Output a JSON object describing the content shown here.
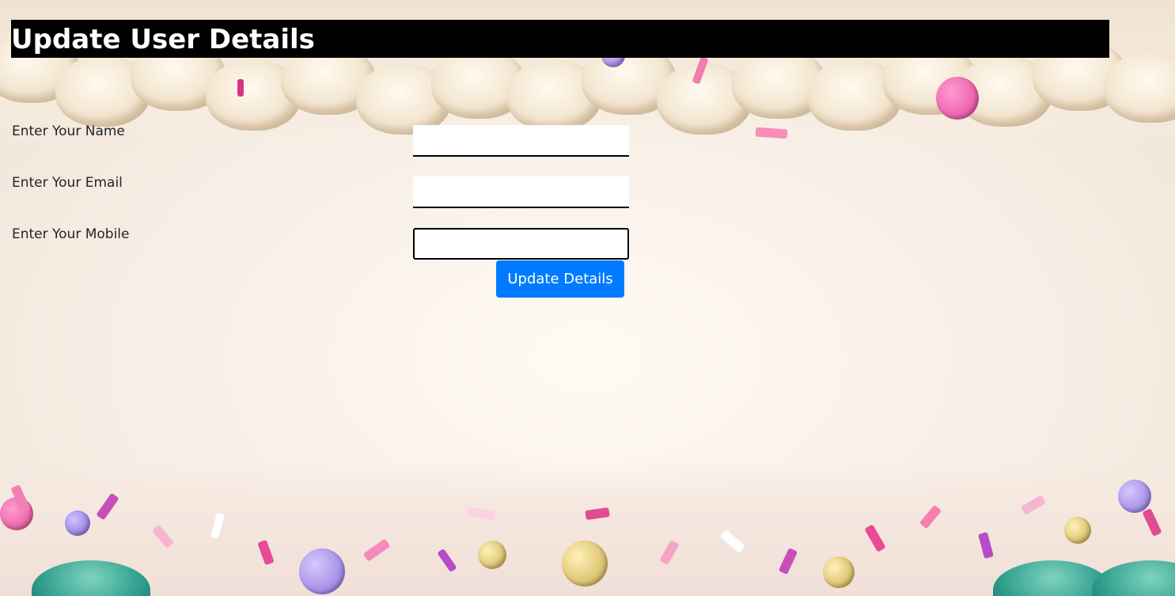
{
  "header": {
    "title": "Update User Details"
  },
  "form": {
    "fields": [
      {
        "label": "Enter Your Name",
        "value": ""
      },
      {
        "label": "Enter Your Email",
        "value": ""
      },
      {
        "label": "Enter Your Mobile",
        "value": ""
      }
    ],
    "submit_label": "Update Details"
  },
  "colors": {
    "header_bg": "#000000",
    "header_text": "#ffffff",
    "button_bg": "#007bff",
    "button_text": "#ffffff",
    "label_text": "#212529"
  }
}
